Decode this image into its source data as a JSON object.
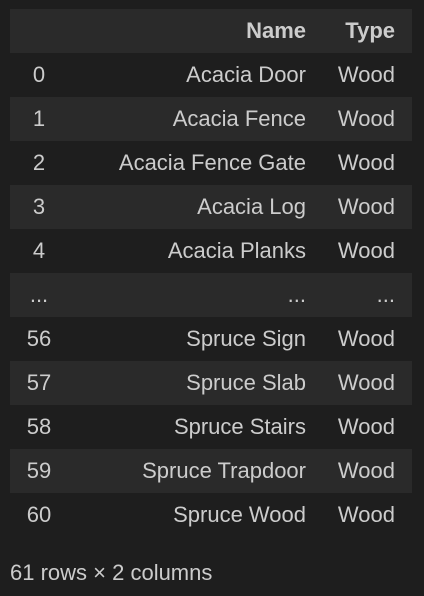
{
  "table": {
    "columns": [
      "",
      "Name",
      "Type"
    ],
    "rows": [
      [
        "0",
        "Acacia Door",
        "Wood"
      ],
      [
        "1",
        "Acacia Fence",
        "Wood"
      ],
      [
        "2",
        "Acacia Fence Gate",
        "Wood"
      ],
      [
        "3",
        "Acacia Log",
        "Wood"
      ],
      [
        "4",
        "Acacia Planks",
        "Wood"
      ],
      [
        "...",
        "...",
        "..."
      ],
      [
        "56",
        "Spruce Sign",
        "Wood"
      ],
      [
        "57",
        "Spruce Slab",
        "Wood"
      ],
      [
        "58",
        "Spruce Stairs",
        "Wood"
      ],
      [
        "59",
        "Spruce Trapdoor",
        "Wood"
      ],
      [
        "60",
        "Spruce Wood",
        "Wood"
      ]
    ]
  },
  "footer": "61 rows × 2 columns"
}
